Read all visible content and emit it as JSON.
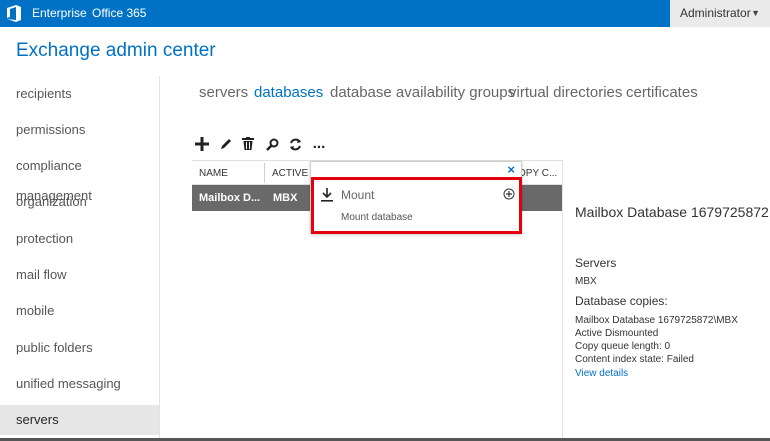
{
  "topbar": {
    "nav": [
      "Enterprise",
      "Office 365"
    ],
    "user": "Administrator"
  },
  "app_title": "Exchange admin center",
  "leftnav": {
    "items": [
      "recipients",
      "permissions",
      "compliance management",
      "organization",
      "protection",
      "mail flow",
      "mobile",
      "public folders",
      "unified messaging",
      "servers"
    ],
    "selected": "servers"
  },
  "tabs": {
    "items": [
      "servers",
      "databases",
      "database availability groups",
      "virtual directories",
      "certificates"
    ],
    "active": "databases"
  },
  "toolbar": {
    "icons": [
      "add-icon",
      "edit-icon",
      "delete-icon",
      "search-icon",
      "refresh-icon",
      "more-icon"
    ],
    "more_label": "..."
  },
  "table": {
    "columns": [
      "NAME",
      "ACTIVE O",
      "OPY C..."
    ],
    "rows": [
      {
        "name": "Mailbox D...",
        "active_on": "MBX"
      }
    ]
  },
  "flyout": {
    "close": "×",
    "action_label": "Mount",
    "action_description": "Mount database"
  },
  "details": {
    "title": "Mailbox Database 1679725872",
    "servers_heading": "Servers",
    "server": "MBX",
    "copies_heading": "Database copies:",
    "copy_name": "Mailbox Database 1679725872\\MBX",
    "copy_status": "Active Dismounted",
    "copy_queue": "Copy queue length:  0",
    "content_index": "Content index state:  Failed",
    "view_details": "View details"
  },
  "colors": {
    "brand": "#0072c6",
    "selected_row": "#696969",
    "highlight": "#e3000f"
  }
}
